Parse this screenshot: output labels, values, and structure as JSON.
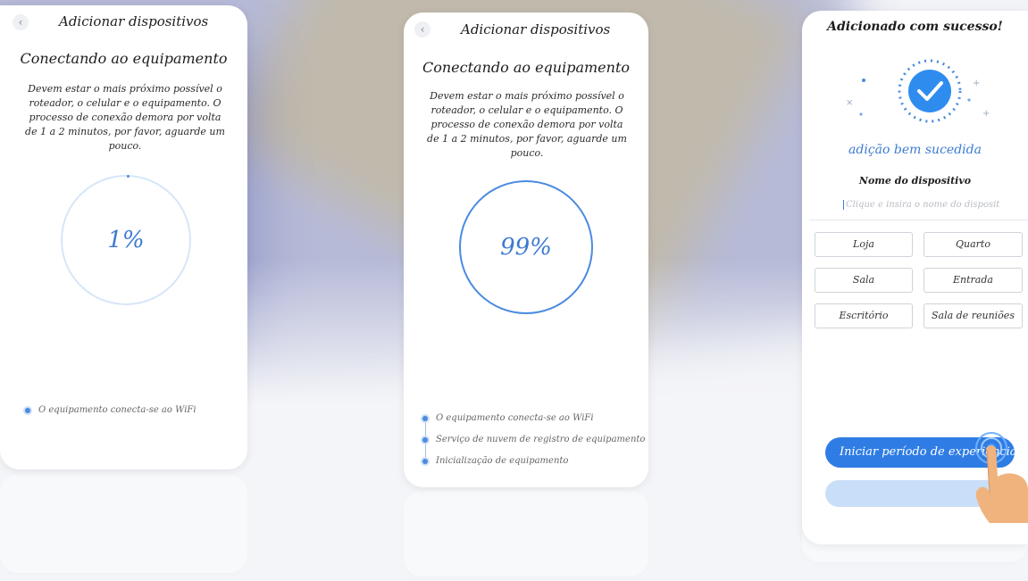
{
  "screens": [
    {
      "title": "Adicionar dispositivos",
      "subtitle": "Conectando ao equipamento",
      "description": "Devem estar o mais próximo possível o roteador, o celular e o equipamento. O processo de conexão demora por volta de 1 a 2 minutos, por favor, aguarde um pouco.",
      "progress_label": "1%",
      "progress": 1,
      "steps": [
        "O equipamento conecta-se ao WiFi"
      ]
    },
    {
      "title": "Adicionar dispositivos",
      "subtitle": "Conectando ao equipamento",
      "description": "Devem estar o mais próximo possível o roteador, o celular e o equipamento. O processo de conexão demora por volta de 1 a 2 minutos, por favor, aguarde um pouco.",
      "progress_label": "99%",
      "progress": 99,
      "steps": [
        "O equipamento conecta-se ao WiFi",
        "Serviço de nuvem de registro de equipamento",
        "Inicialização de equipamento"
      ]
    },
    {
      "title": "Adicionado com sucesso!",
      "success_text": "adição bem sucedida",
      "name_label": "Nome do dispositivo",
      "name_placeholder": "Clique e insira o nome do disposit",
      "rooms": [
        "Loja",
        "Quarto",
        "Sala",
        "Entrada",
        "Escritório",
        "Sala de reuniões"
      ],
      "cta_label": "Iniciar período de experiência"
    }
  ],
  "icons": {
    "back": "chevron-left-icon",
    "success": "check-circle-icon",
    "hand": "pointing-hand-icon"
  },
  "colors": {
    "accent": "#2f7de4",
    "progress": "#4a8be0",
    "success_text": "#3d7bd1"
  }
}
